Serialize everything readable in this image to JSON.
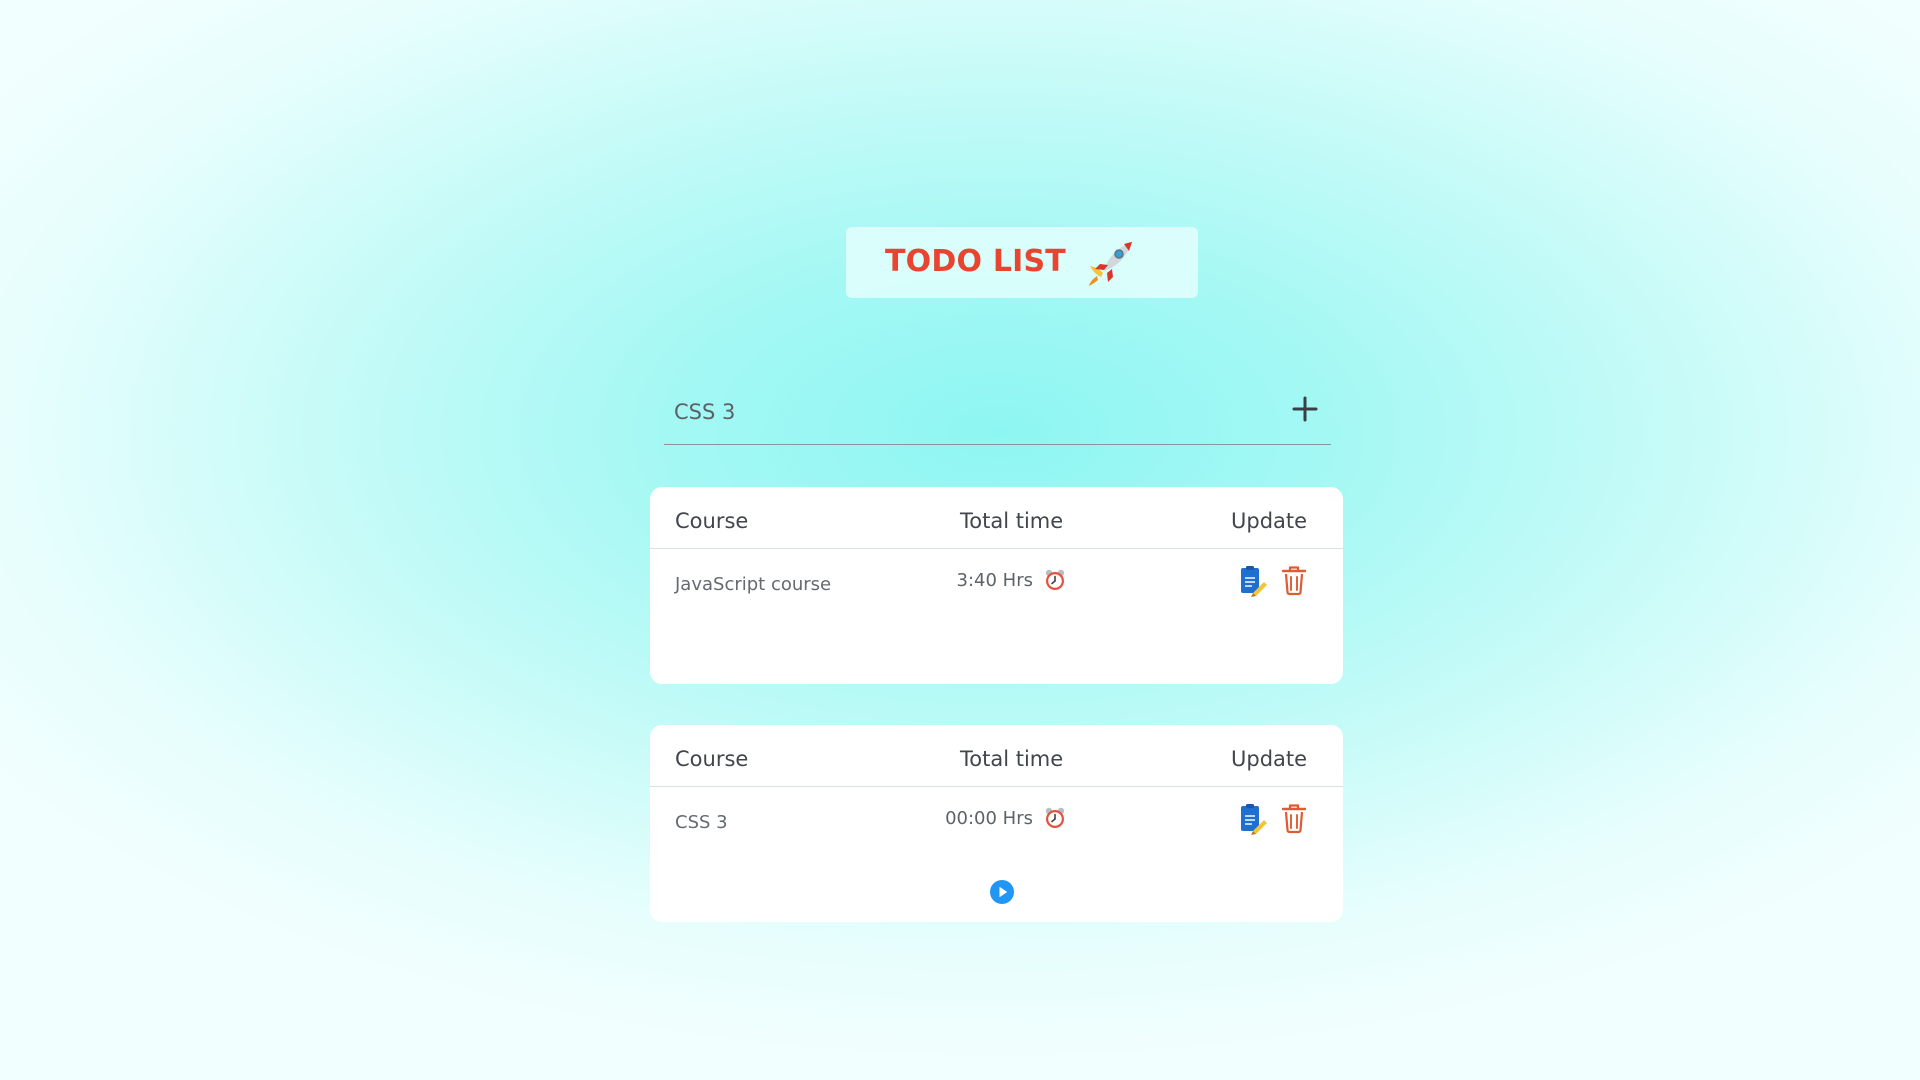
{
  "header": {
    "title": "TODO LIST",
    "icon": "rocket-icon"
  },
  "add_form": {
    "input_value": "CSS 3",
    "add_icon": "plus-icon"
  },
  "cards": [
    {
      "columns": {
        "course": "Course",
        "total_time": "Total time",
        "update": "Update"
      },
      "row": {
        "course": "JavaScript course",
        "time": "3:40 Hrs",
        "time_icon": "alarm-clock-icon",
        "actions": [
          "edit-icon",
          "trash-icon"
        ]
      }
    },
    {
      "columns": {
        "course": "Course",
        "total_time": "Total time",
        "update": "Update"
      },
      "row": {
        "course": "CSS 3",
        "time": "00:00 Hrs",
        "time_icon": "alarm-clock-icon",
        "actions": [
          "edit-icon",
          "trash-icon"
        ]
      },
      "control_icon": "play-icon"
    }
  ],
  "colors": {
    "title": "#e8442f",
    "edit_blue": "#1f6fd1",
    "delete": "#df5b31",
    "play": "#2196f3",
    "background": "#8ef6f2"
  }
}
